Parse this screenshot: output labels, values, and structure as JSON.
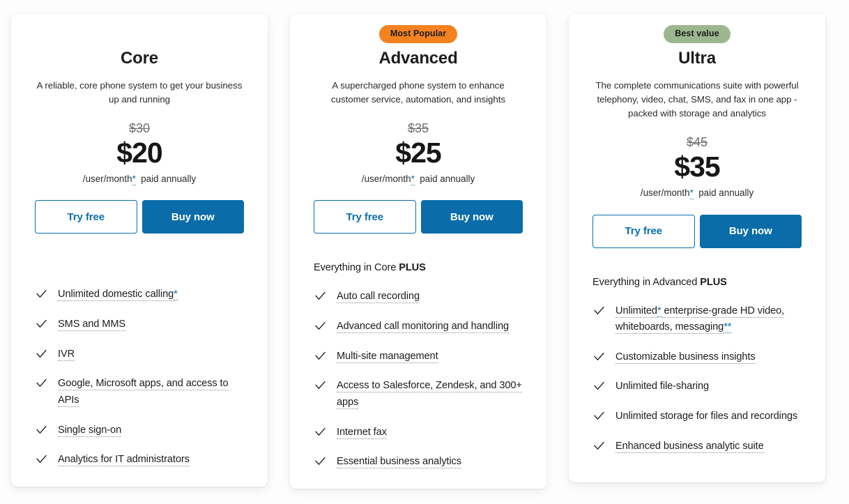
{
  "page": {
    "background_color": "#fdfdfd",
    "accent_blue": "#0b6fb0",
    "button_blue": "#0a6ca8",
    "badge_orange": "#f58220",
    "badge_green": "#9cb78f"
  },
  "common": {
    "try_free_label": "Try free",
    "buy_now_label": "Buy now",
    "terms_prefix": "/user/month",
    "terms_asterisk": "*",
    "terms_suffix": "paid annually",
    "check_icon": "check-icon"
  },
  "plans": [
    {
      "id": "core",
      "badge": null,
      "badge_color": null,
      "name": "Core",
      "description": "A reliable, core phone system to get your business up and running",
      "old_price": "$30",
      "price": "$20",
      "intro": null,
      "intro_bold": null,
      "features": [
        {
          "text": "Unlimited domestic calling",
          "underline": true,
          "sup": "*"
        },
        {
          "text": "SMS and MMS",
          "underline": true,
          "sup": null
        },
        {
          "text": "IVR",
          "underline": true,
          "sup": null
        },
        {
          "text": "Google, Microsoft apps, and access to APIs",
          "underline": true,
          "sup": null
        },
        {
          "text": "Single sign-on",
          "underline": true,
          "sup": null
        },
        {
          "text": "Analytics for IT administrators",
          "underline": true,
          "sup": null
        }
      ]
    },
    {
      "id": "advanced",
      "badge": "Most Popular",
      "badge_color": "#f58220",
      "name": "Advanced",
      "description": "A supercharged phone system to enhance customer service, automation, and insights",
      "old_price": "$35",
      "price": "$25",
      "intro": "Everything in Core ",
      "intro_bold": "PLUS",
      "features": [
        {
          "text": "Auto call recording",
          "underline": true,
          "sup": null
        },
        {
          "text": "Advanced call monitoring and handling",
          "underline": true,
          "sup": null
        },
        {
          "text": "Multi-site management",
          "underline": true,
          "sup": null
        },
        {
          "text": "Access to Salesforce, Zendesk, and 300+ apps",
          "underline": true,
          "sup": null
        },
        {
          "text": "Internet fax",
          "underline": true,
          "sup": null
        },
        {
          "text": "Essential business analytics",
          "underline": true,
          "sup": null
        }
      ]
    },
    {
      "id": "ultra",
      "badge": "Best value",
      "badge_color": "#9cb78f",
      "name": "Ultra",
      "description": "The complete communications suite with powerful telephony, video, chat, SMS, and fax in one app - packed with storage and analytics",
      "old_price": "$45",
      "price": "$35",
      "intro": "Everything in Advanced ",
      "intro_bold": "PLUS",
      "features": [
        {
          "text": "Unlimited",
          "underline": true,
          "sup": "*",
          "text2": " enterprise-grade HD video, whiteboards, messaging",
          "sup2": "**"
        },
        {
          "text": "Customizable business insights",
          "underline": true,
          "sup": null
        },
        {
          "text": "Unlimited file-sharing",
          "underline": false,
          "sup": null
        },
        {
          "text": "Unlimited storage for files and recordings",
          "underline": false,
          "sup": null
        },
        {
          "text": "Enhanced business analytic suite",
          "underline": true,
          "sup": null
        }
      ]
    }
  ]
}
